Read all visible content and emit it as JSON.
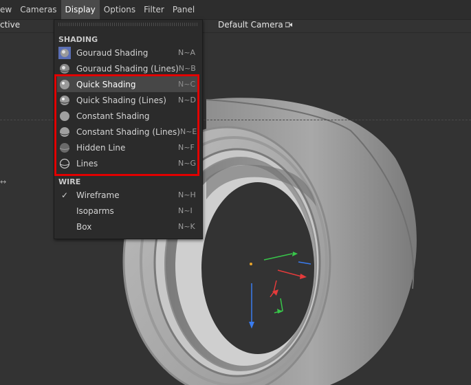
{
  "menubar": {
    "items": [
      {
        "label": "ew",
        "active": false
      },
      {
        "label": "Cameras",
        "active": false
      },
      {
        "label": "Display",
        "active": true
      },
      {
        "label": "Options",
        "active": false
      },
      {
        "label": "Filter",
        "active": false
      },
      {
        "label": "Panel",
        "active": false
      }
    ]
  },
  "viewport": {
    "left_label": "ctive",
    "camera_label": "Default Camera",
    "left_arrow": "↔"
  },
  "menu": {
    "shading_header": "SHADING",
    "shading_items": [
      {
        "label": "Gouraud Shading",
        "shortcut": "N~A",
        "icon": "gouraud-shading-icon"
      },
      {
        "label": "Gouraud Shading (Lines)",
        "shortcut": "N~B",
        "icon": "gouraud-shading-lines-icon"
      },
      {
        "label": "Quick Shading",
        "shortcut": "N~C",
        "icon": "quick-shading-icon",
        "highlighted": true
      },
      {
        "label": "Quick Shading (Lines)",
        "shortcut": "N~D",
        "icon": "quick-shading-lines-icon"
      },
      {
        "label": "Constant Shading",
        "shortcut": "",
        "icon": "constant-shading-icon"
      },
      {
        "label": "Constant Shading (Lines)",
        "shortcut": "N~E",
        "icon": "constant-shading-lines-icon"
      },
      {
        "label": "Hidden Line",
        "shortcut": "N~F",
        "icon": "hidden-line-icon"
      },
      {
        "label": "Lines",
        "shortcut": "N~G",
        "icon": "lines-icon"
      }
    ],
    "wire_header": "WIRE",
    "wire_items": [
      {
        "label": "Wireframe",
        "shortcut": "N~H",
        "checked": true
      },
      {
        "label": "Isoparms",
        "shortcut": "N~I",
        "checked": false
      },
      {
        "label": "Box",
        "shortcut": "N~K",
        "checked": false
      }
    ],
    "check_glyph": "✓"
  },
  "colors": {
    "highlight_box": "#e10000",
    "axis_x": "#e53b3b",
    "axis_y": "#38c64a",
    "axis_z": "#3a7cf0"
  }
}
